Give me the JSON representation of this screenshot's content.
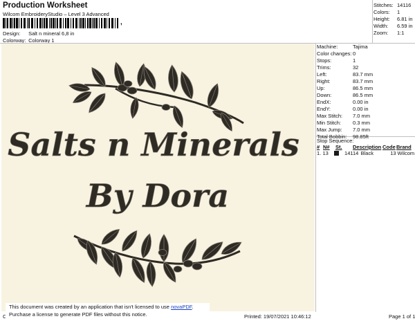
{
  "header": {
    "title": "Production Worksheet",
    "software": "Wilcom EmbroideryStudio – Level 3 Advanced",
    "design_label": "Design:",
    "design_value": "Salt n mineral 6,8 in",
    "colorway_label": "Colorway:",
    "colorway_value": "Colorway 1",
    "barcode_suffix": ","
  },
  "stats": [
    {
      "label": "Stitches:",
      "value": "14116"
    },
    {
      "label": "Colors:",
      "value": "1"
    },
    {
      "label": "Height:",
      "value": "6.81 in"
    },
    {
      "label": "Width:",
      "value": "6.59 in"
    },
    {
      "label": "Zoom:",
      "value": "1:1"
    }
  ],
  "machine": [
    {
      "label": "Machine:",
      "value": "Tajima"
    },
    {
      "label": "Color changes:",
      "value": "0"
    },
    {
      "label": "Stops:",
      "value": "1"
    },
    {
      "label": "Trims:",
      "value": "32"
    },
    {
      "label": "Left:",
      "value": "83.7 mm"
    },
    {
      "label": "Right:",
      "value": "83.7 mm"
    },
    {
      "label": "Up:",
      "value": "86.5 mm"
    },
    {
      "label": "Down:",
      "value": "86.5 mm"
    },
    {
      "label": "EndX:",
      "value": "0.00 in"
    },
    {
      "label": "EndY:",
      "value": "0.00 in"
    },
    {
      "label": "Max Stitch:",
      "value": "7.0 mm"
    },
    {
      "label": "Min Stitch:",
      "value": "0.3 mm"
    },
    {
      "label": "Max Jump:",
      "value": "7.0 mm"
    },
    {
      "label": "Total Bobbin:",
      "value": "98.85ft"
    }
  ],
  "stop_sequence": {
    "label": "Stop Sequence:",
    "headers": [
      "#",
      "N#",
      "St.",
      "Description",
      "Code",
      "Brand"
    ],
    "rows": [
      {
        "num": "1.",
        "n": "13",
        "st": "14114",
        "desc": "Black",
        "code": "13",
        "brand": "Wilcom",
        "color": "#1a1a1a"
      }
    ]
  },
  "design_text": {
    "line1": "Salts n Minerals",
    "line2": "By Dora"
  },
  "footer": {
    "left": "Cr",
    "printed": "Printed: 19/07/2021 10:46:12",
    "page": "Page 1 of 1"
  },
  "notice": {
    "line1_prefix": "This document was created by an application that isn't licensed to use ",
    "link": "novaPDF",
    "line1_suffix": ".",
    "line2": "Purchase a license to generate PDF files without this notice."
  },
  "colors": {
    "canvas_bg": "#f8f3e1",
    "thread": "#2e2a24",
    "link": "#1a3fbf"
  }
}
